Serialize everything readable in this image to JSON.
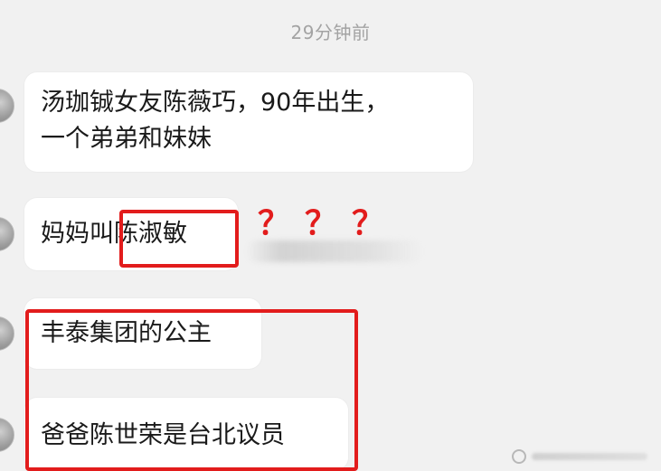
{
  "chat": {
    "timestamp": "29分钟前",
    "messages": [
      {
        "lines": [
          "汤珈铖女友陈薇巧，90年出生，",
          "一个弟弟和妹妹"
        ]
      },
      {
        "prefix": "妈妈叫",
        "highlight": "陈淑敏"
      },
      {
        "text": "丰泰集团的公主"
      },
      {
        "text": "爸爸陈世荣是台北议员"
      }
    ],
    "annotation": "？？？"
  },
  "colors": {
    "annotation_red": "#e21c1c",
    "background": "#f1f1f1",
    "bubble": "#ffffff",
    "timestamp": "#a3a3a3"
  }
}
